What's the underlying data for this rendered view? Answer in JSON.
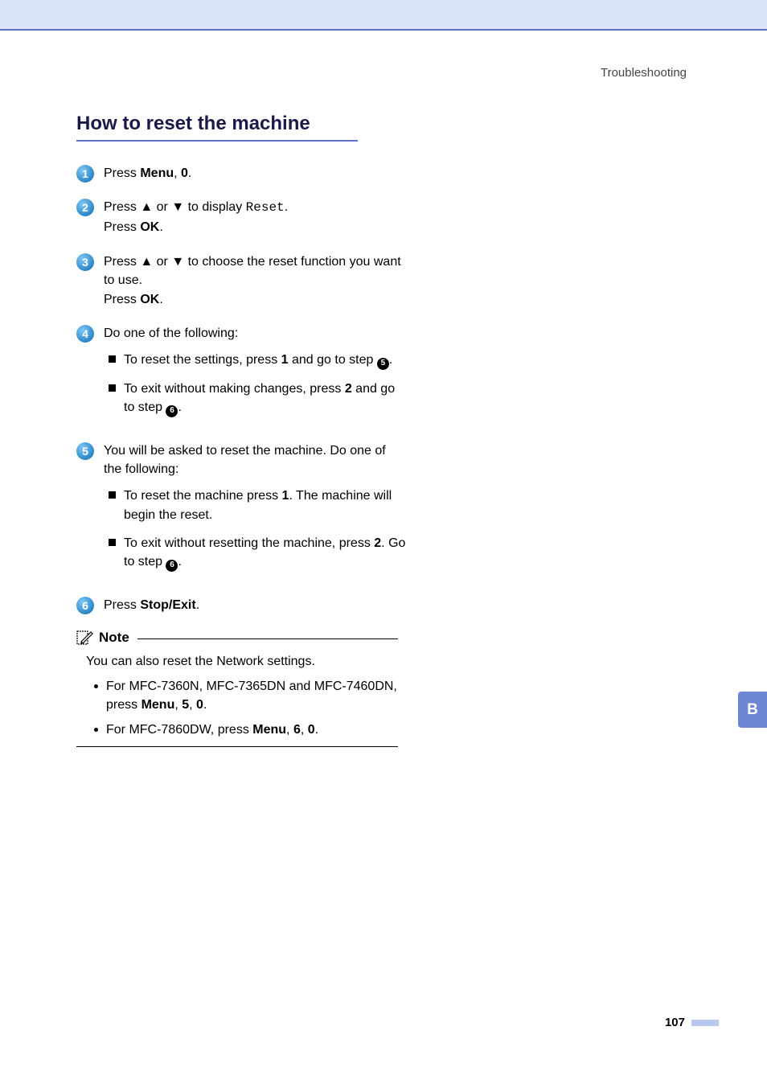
{
  "header": {
    "section": "Troubleshooting"
  },
  "heading": "How to reset the machine",
  "steps": {
    "s1": {
      "num": "1",
      "l1a": "Press ",
      "l1b": "Menu",
      "l1c": ", ",
      "l1d": "0",
      "l1e": "."
    },
    "s2": {
      "num": "2",
      "l1a": "Press ",
      "l1b": "a",
      "l1c": " or ",
      "l1d": "b",
      "l1e": " to display ",
      "l1f": "Reset",
      "l1g": ".",
      "l2a": "Press ",
      "l2b": "OK",
      "l2c": "."
    },
    "s3": {
      "num": "3",
      "l1a": "Press ",
      "l1b": "a",
      "l1c": " or ",
      "l1d": "b",
      "l1e": " to choose the reset function you want to use.",
      "l2a": "Press ",
      "l2b": "OK",
      "l2c": "."
    },
    "s4": {
      "num": "4",
      "l1": "Do one of the following:",
      "b1a": "To reset the settings, press ",
      "b1b": "1",
      "b1c": " and go to step ",
      "b1d": "5",
      "b1e": ".",
      "b2a": "To exit without making changes, press ",
      "b2b": "2",
      "b2c": " and go to step ",
      "b2d": "6",
      "b2e": "."
    },
    "s5": {
      "num": "5",
      "l1": "You will be asked to reset the machine. Do one of the following:",
      "b1a": "To reset the machine press ",
      "b1b": "1",
      "b1c": ". The machine will begin the reset.",
      "b2a": "To exit without resetting the machine, press ",
      "b2b": "2",
      "b2c": ". Go to step ",
      "b2d": "6",
      "b2e": "."
    },
    "s6": {
      "num": "6",
      "l1a": "Press ",
      "l1b": "Stop/Exit",
      "l1c": "."
    }
  },
  "note": {
    "label": "Note",
    "text": "You can also reset the Network settings.",
    "b1a": "For MFC-7360N, MFC-7365DN and MFC-7460DN, press ",
    "b1b": "Menu",
    "b1c": ", ",
    "b1d": "5",
    "b1e": ", ",
    "b1f": "0",
    "b1g": ".",
    "b2a": "For MFC-7860DW, press ",
    "b2b": "Menu",
    "b2c": ", ",
    "b2d": "6",
    "b2e": ", ",
    "b2f": "0",
    "b2g": "."
  },
  "sidebar": {
    "letter": "B"
  },
  "footer": {
    "page": "107"
  }
}
